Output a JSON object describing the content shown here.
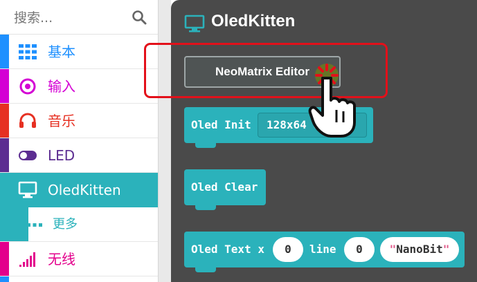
{
  "sidebar": {
    "search_placeholder": "搜索...",
    "categories": [
      {
        "label": "基本",
        "color": "#1e90ff",
        "icon": "grid-icon"
      },
      {
        "label": "输入",
        "color": "#d400d4",
        "icon": "target-icon"
      },
      {
        "label": "音乐",
        "color": "#e63022",
        "icon": "headphones-icon"
      },
      {
        "label": "LED",
        "color": "#5c2d91",
        "icon": "toggle-icon"
      },
      {
        "label": "OledKitten",
        "color": "#2bb2bb",
        "icon": "monitor-icon"
      },
      {
        "label": "更多",
        "color": "#2bb2bb",
        "icon": "more-icon"
      },
      {
        "label": "无线",
        "color": "#e3008c",
        "icon": "signal-icon"
      }
    ]
  },
  "workspace": {
    "title": "OledKitten",
    "neomatrix_button": "NeoMatrix Editor",
    "blocks": {
      "oled_init": {
        "label": "Oled Init",
        "field": "128x64 0"
      },
      "oled_clear": {
        "label": "Oled Clear"
      },
      "oled_text": {
        "label_x": "Oled Text x",
        "x_value": "0",
        "label_line": "line",
        "line_value": "0",
        "text_value": "NanoBit"
      }
    }
  },
  "colors": {
    "accent": "#2bb2bb",
    "highlight": "#e3101a",
    "workspace_bg": "#4a4a4a"
  }
}
